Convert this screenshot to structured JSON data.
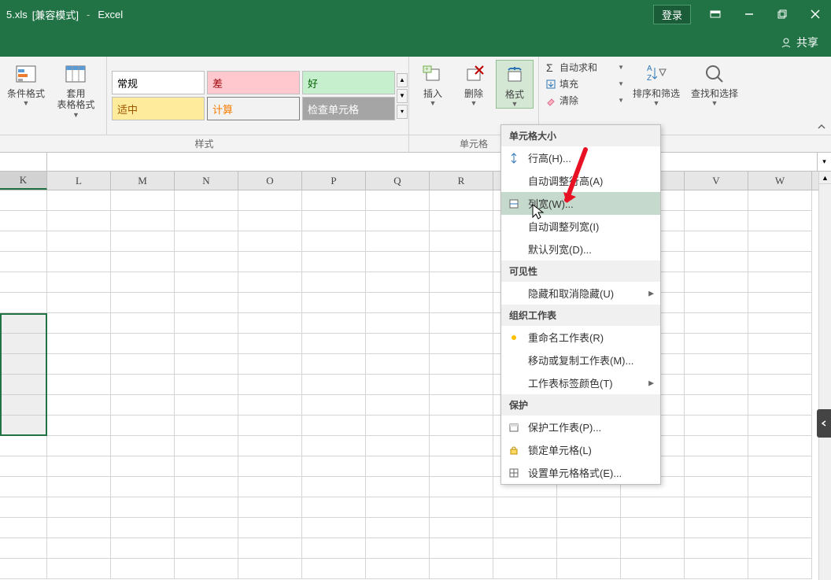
{
  "titlebar": {
    "filename": "5.xls",
    "mode": "[兼容模式]",
    "dash": "-",
    "app": "Excel",
    "login": "登录"
  },
  "share_label": "共享",
  "ribbon": {
    "cond_format": "条件格式",
    "table_format": "套用\n表格格式",
    "styles": {
      "normal": "常规",
      "bad": "差",
      "good": "好",
      "neutral": "适中",
      "calc": "计算",
      "check": "检查单元格"
    },
    "styles_label": "样式",
    "insert": "插入",
    "delete": "删除",
    "format": "格式",
    "cells_label": "单元格",
    "autosum": "自动求和",
    "fill": "填充",
    "clear": "清除",
    "sort_filter": "排序和筛选",
    "find_select": "查找和选择"
  },
  "columns": [
    "K",
    "L",
    "M",
    "N",
    "O",
    "P",
    "Q",
    "R",
    "",
    "",
    "",
    "V",
    "W"
  ],
  "dropdown": {
    "sec_cellsize": "单元格大小",
    "row_height": "行高(H)...",
    "autofit_row": "自动调整行高(A)",
    "col_width": "列宽(W)...",
    "autofit_col": "自动调整列宽(I)",
    "default_width": "默认列宽(D)...",
    "sec_visibility": "可见性",
    "hide_unhide": "隐藏和取消隐藏(U)",
    "sec_organize": "组织工作表",
    "rename": "重命名工作表(R)",
    "move_copy": "移动或复制工作表(M)...",
    "tab_color": "工作表标签颜色(T)",
    "sec_protect": "保护",
    "protect_sheet": "保护工作表(P)...",
    "lock_cell": "锁定单元格(L)",
    "format_cells": "设置单元格格式(E)..."
  }
}
